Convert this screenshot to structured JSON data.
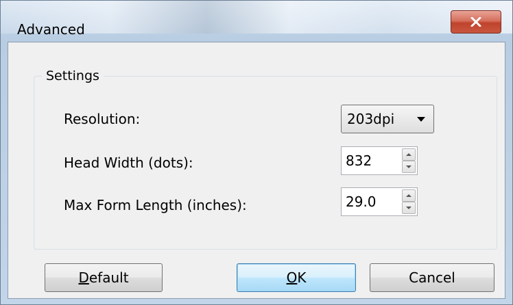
{
  "window": {
    "title": "Advanced",
    "close_icon": "close-x-icon"
  },
  "settings": {
    "group_label": "Settings",
    "resolution": {
      "label": "Resolution:",
      "value": "203dpi"
    },
    "head_width": {
      "label": "Head Width (dots):",
      "value": "832"
    },
    "max_form_length": {
      "label": "Max Form Length (inches):",
      "value": "29.0"
    }
  },
  "buttons": {
    "default": {
      "mnemonic": "D",
      "rest": "efault"
    },
    "ok": {
      "mnemonic": "O",
      "rest": "K"
    },
    "cancel": {
      "label": "Cancel"
    }
  },
  "colors": {
    "close_button": "#c8563f",
    "ok_button_border": "#3c7fb1",
    "dialog_background": "#f0f0f0"
  }
}
